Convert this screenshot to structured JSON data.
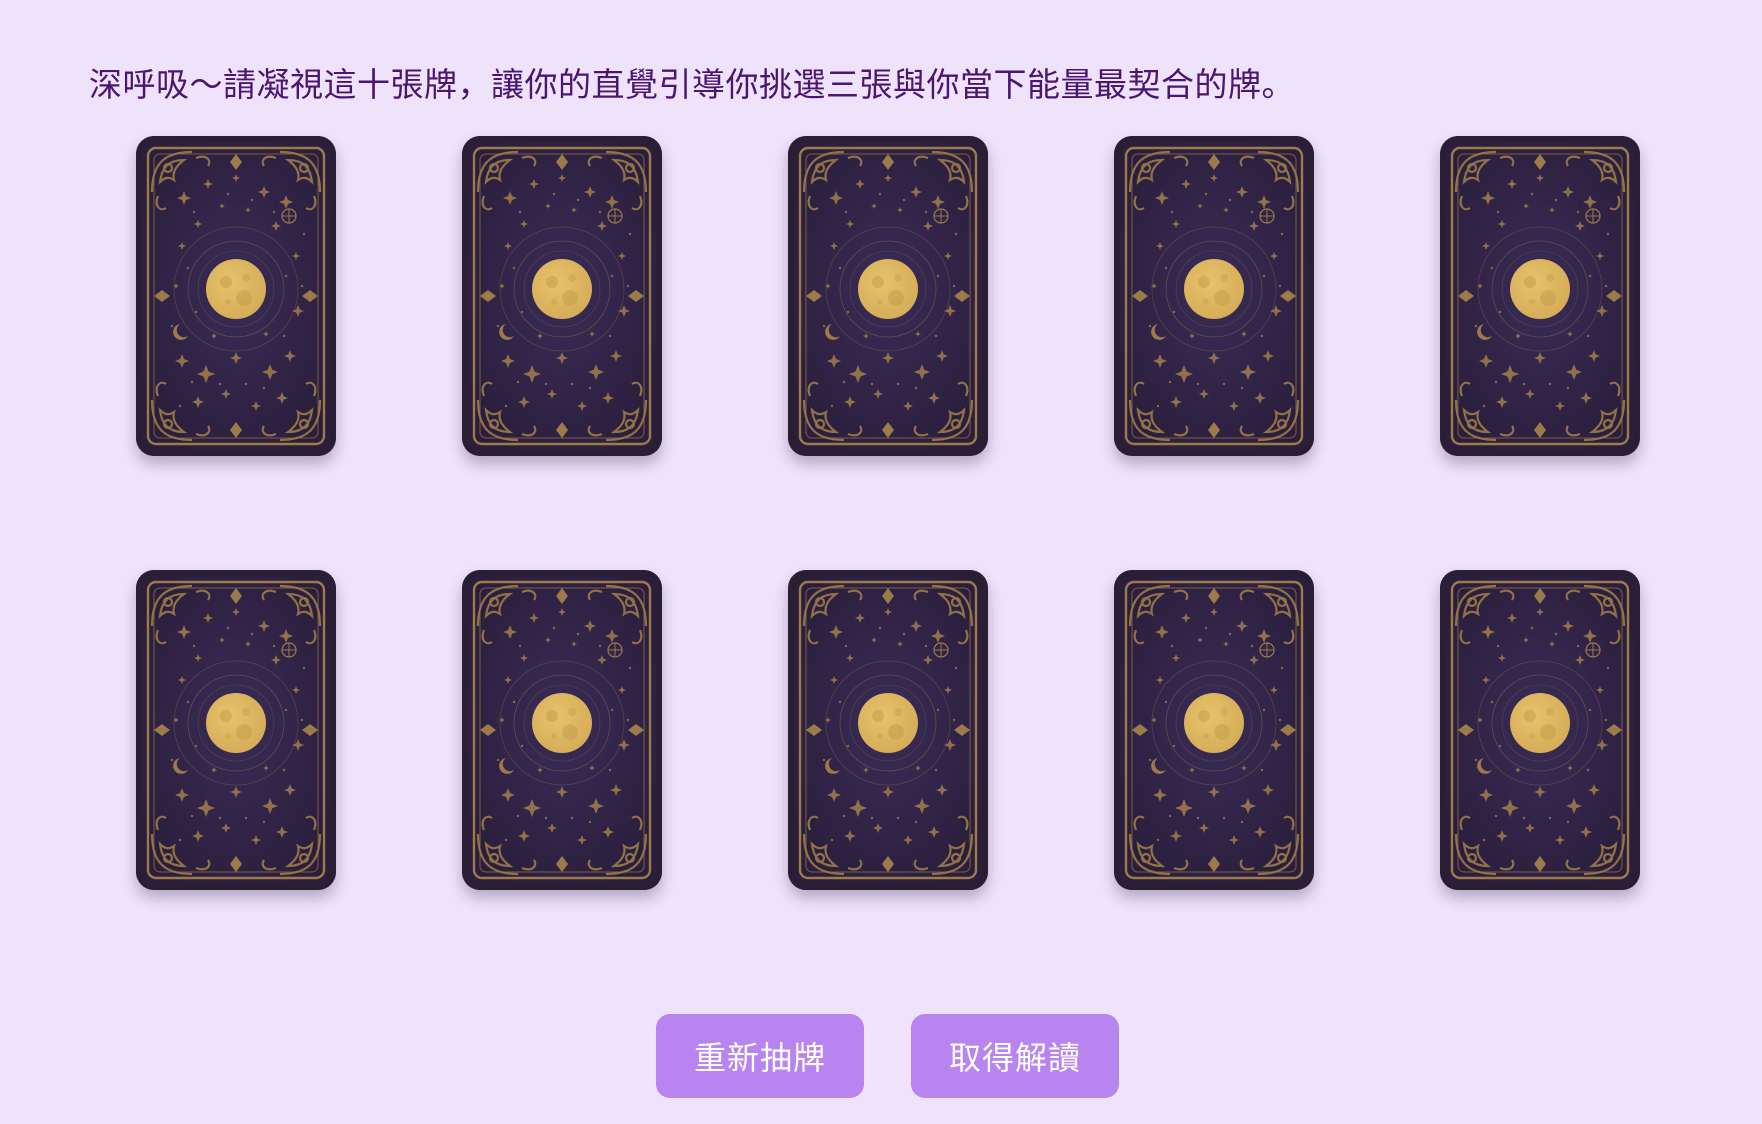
{
  "instruction": "深呼吸～請凝視這十張牌，讓你的直覺引導你挑選三張與你當下能量最契合的牌。",
  "cards": [
    {
      "icon": "card-back-moon"
    },
    {
      "icon": "card-back-moon"
    },
    {
      "icon": "card-back-moon"
    },
    {
      "icon": "card-back-moon"
    },
    {
      "icon": "card-back-moon"
    },
    {
      "icon": "card-back-moon"
    },
    {
      "icon": "card-back-moon"
    },
    {
      "icon": "card-back-moon"
    },
    {
      "icon": "card-back-moon"
    },
    {
      "icon": "card-back-moon"
    }
  ],
  "buttons": {
    "redraw_label": "重新抽牌",
    "reading_label": "取得解讀"
  },
  "colors": {
    "background": "#efe2fb",
    "instruction_text": "#4a1670",
    "button": "#b784f0",
    "card_back": "#2f2347",
    "card_gold": "#9c7a4a",
    "moon": "#d6ad58"
  }
}
